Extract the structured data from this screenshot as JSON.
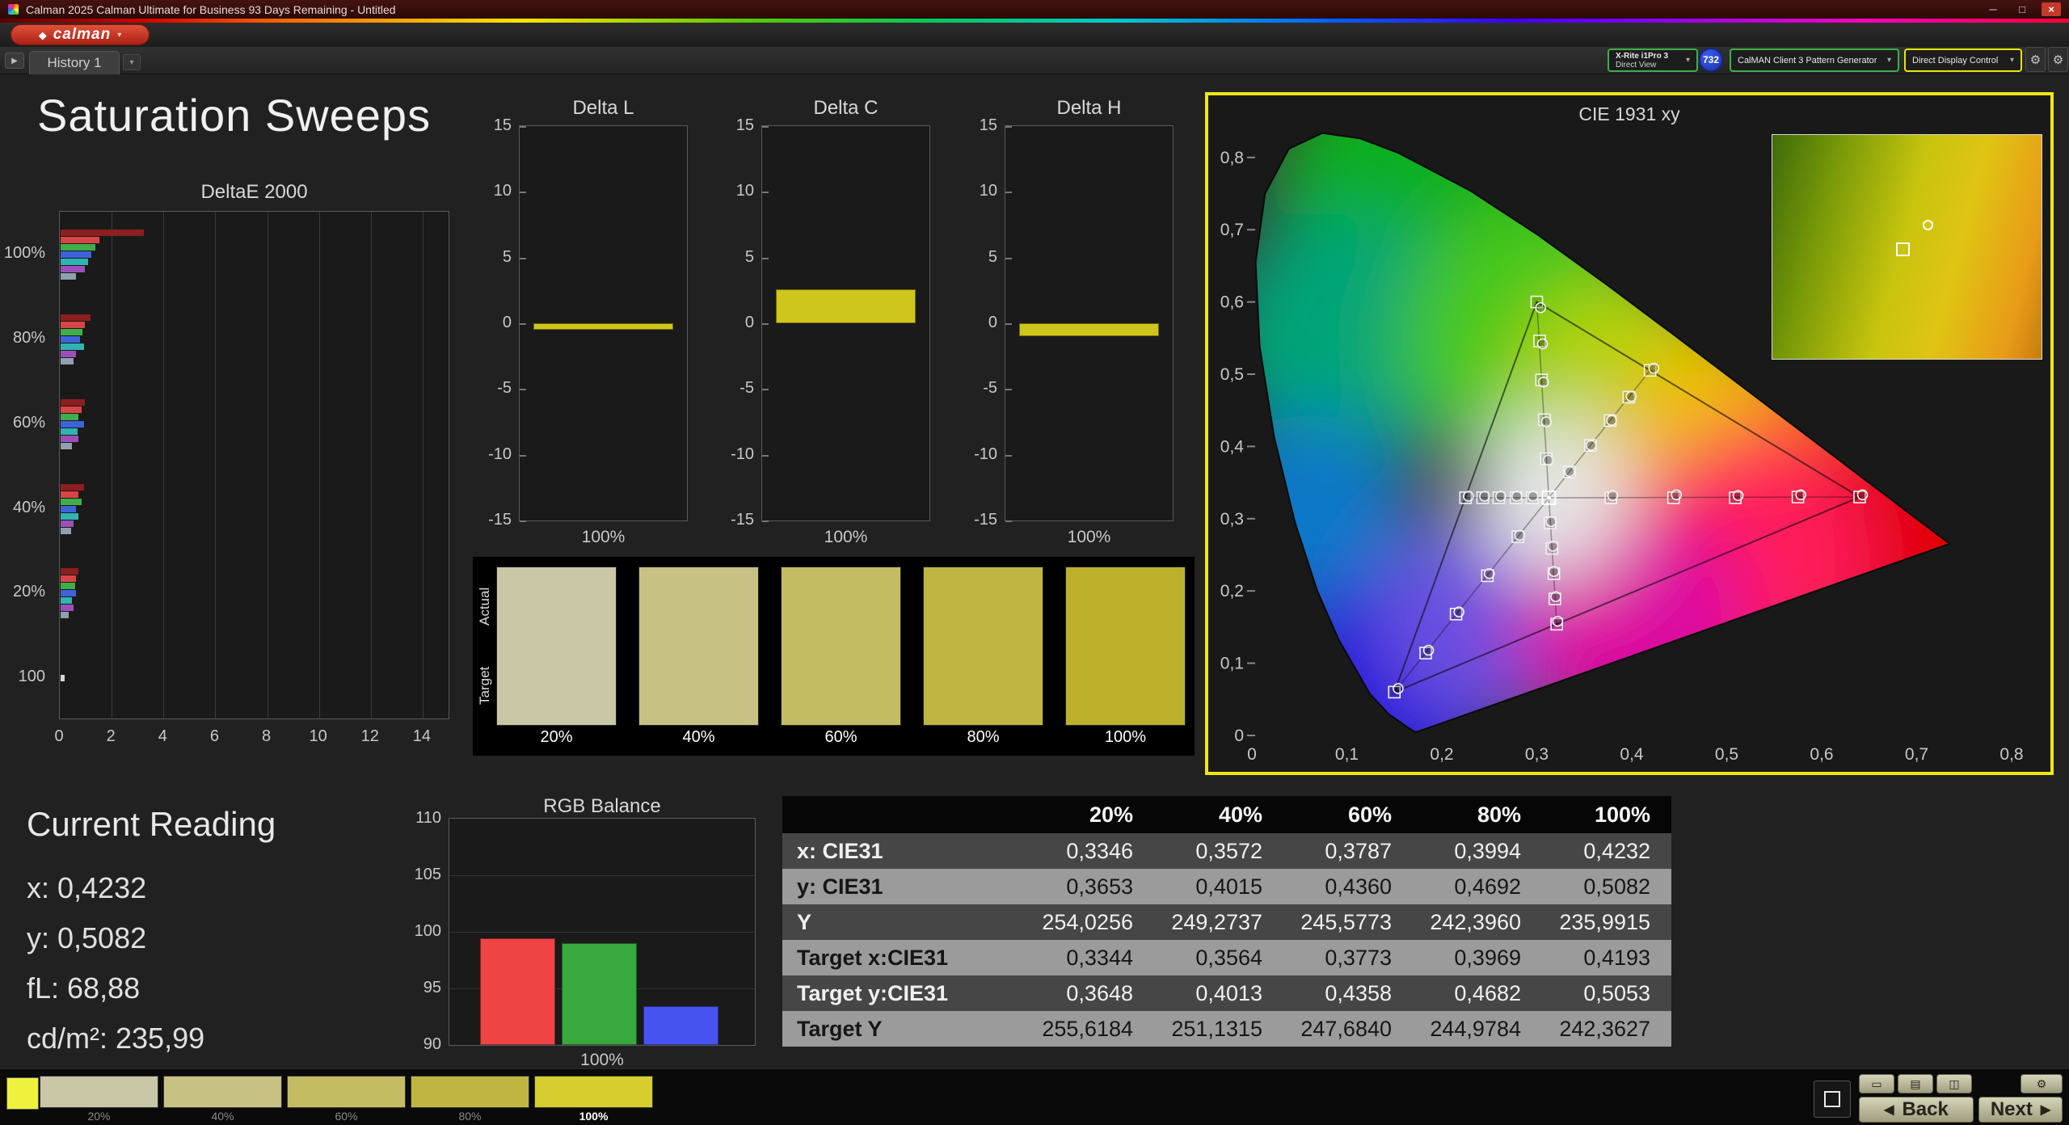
{
  "window": {
    "title": "Calman 2025 Calman Ultimate for Business 93 Days Remaining  - Untitled"
  },
  "logo": {
    "label": "calman"
  },
  "tab_bar": {
    "history_tab": "History 1"
  },
  "devices": {
    "meter_line1": "X-Rite i1Pro 3",
    "meter_line2": "Direct View",
    "meter_badge": "732",
    "source_label": "CalMAN Client 3 Pattern Generator",
    "display_label": "Direct Display Control",
    "meter_border_color": "#3fae4a",
    "source_border_color": "#3fae4a",
    "display_border_color": "#e6e600"
  },
  "page": {
    "title": "Saturation Sweeps"
  },
  "current_reading": {
    "title": "Current Reading",
    "x": "x: 0,4232",
    "y": "y: 0,5082",
    "fl": "fL: 68,88",
    "cd": "cd/m²: 235,99"
  },
  "saturation_swatches": {
    "row_label_top": "Actual",
    "row_label_bottom": "Target",
    "levels": [
      "20%",
      "40%",
      "60%",
      "80%",
      "100%"
    ],
    "colors": [
      "#c9c7a6",
      "#c7c184",
      "#c4bc62",
      "#c0b543",
      "#bdb02b"
    ]
  },
  "measurement_table": {
    "headers": [
      "",
      "20%",
      "40%",
      "60%",
      "80%",
      "100%"
    ],
    "rows": [
      {
        "label": "x: CIE31",
        "shade": "dark",
        "values": [
          "0,3346",
          "0,3572",
          "0,3787",
          "0,3994",
          "0,4232"
        ]
      },
      {
        "label": "y: CIE31",
        "shade": "light",
        "values": [
          "0,3653",
          "0,4015",
          "0,4360",
          "0,4692",
          "0,5082"
        ]
      },
      {
        "label": "Y",
        "shade": "dark",
        "values": [
          "254,0256",
          "249,2737",
          "245,5773",
          "242,3960",
          "235,9915"
        ]
      },
      {
        "label": "Target x:CIE31",
        "shade": "light",
        "values": [
          "0,3344",
          "0,3564",
          "0,3773",
          "0,3969",
          "0,4193"
        ]
      },
      {
        "label": "Target y:CIE31",
        "shade": "dark",
        "values": [
          "0,3648",
          "0,4013",
          "0,4358",
          "0,4682",
          "0,5053"
        ]
      },
      {
        "label": "Target Y",
        "shade": "light",
        "values": [
          "255,6184",
          "251,1315",
          "247,6840",
          "244,9784",
          "242,3627"
        ]
      }
    ]
  },
  "bottom_bar": {
    "current_color": "#eef23c",
    "levels": [
      {
        "label": "20%",
        "color": "#c9c7a6"
      },
      {
        "label": "40%",
        "color": "#c7c184"
      },
      {
        "label": "60%",
        "color": "#c4bc62"
      },
      {
        "label": "80%",
        "color": "#c0b543"
      },
      {
        "label": "100%",
        "color": "#d6cd2e"
      }
    ],
    "selected_level": "100%",
    "back_label": "Back",
    "next_label": "Next"
  },
  "chart_data": [
    {
      "id": "deltaE2000",
      "type": "bar",
      "title": "DeltaE 2000",
      "orientation": "horizontal",
      "categories": [
        "100%",
        "80%",
        "60%",
        "40%",
        "20%",
        "100"
      ],
      "xlim": [
        0,
        15
      ],
      "xticks": [
        0,
        2,
        4,
        6,
        8,
        10,
        12,
        14
      ],
      "series_colors": [
        "#8c1f1f",
        "#d94545",
        "#3fae4a",
        "#3f62d9",
        "#2fb3b3",
        "#9a50b8",
        "#8fa0b0"
      ],
      "groups": [
        [
          3.2,
          1.5,
          1.35,
          1.2,
          1.05,
          0.95,
          0.6
        ],
        [
          1.15,
          0.95,
          0.85,
          0.75,
          0.9,
          0.6,
          0.5
        ],
        [
          0.95,
          0.8,
          0.7,
          0.9,
          0.65,
          0.7,
          0.45
        ],
        [
          0.9,
          0.7,
          0.8,
          0.6,
          0.7,
          0.5,
          0.4
        ],
        [
          0.7,
          0.6,
          0.55,
          0.6,
          0.45,
          0.5,
          0.3
        ],
        [
          0.15
        ]
      ]
    },
    {
      "id": "deltaL",
      "type": "bar",
      "title": "Delta L",
      "ylim": [
        -15,
        15
      ],
      "yticks": [
        15,
        10,
        5,
        0,
        -5,
        -10,
        -15
      ],
      "xlabel": "100%",
      "value": -0.5,
      "bar_color": "#cfc61d"
    },
    {
      "id": "deltaC",
      "type": "bar",
      "title": "Delta C",
      "ylim": [
        -15,
        15
      ],
      "yticks": [
        15,
        10,
        5,
        0,
        -5,
        -10,
        -15
      ],
      "xlabel": "100%",
      "value": 2.6,
      "bar_color": "#cfc61d"
    },
    {
      "id": "deltaH",
      "type": "bar",
      "title": "Delta H",
      "ylim": [
        -15,
        15
      ],
      "yticks": [
        15,
        10,
        5,
        0,
        -5,
        -10,
        -15
      ],
      "xlabel": "100%",
      "value": -1.0,
      "bar_color": "#cfc61d"
    },
    {
      "id": "rgbBalance",
      "type": "bar",
      "title": "RGB Balance",
      "categories": [
        "Red",
        "Green",
        "Blue"
      ],
      "values": [
        99.4,
        99.0,
        93.4
      ],
      "bar_colors": [
        "#ef4444",
        "#37a93f",
        "#4753ef"
      ],
      "ylim": [
        90,
        110
      ],
      "yticks": [
        110,
        105,
        100,
        95,
        90
      ],
      "xlabel": "100%"
    },
    {
      "id": "cie",
      "type": "scatter",
      "title": "CIE 1931 xy",
      "xtick_labels": [
        "0",
        "0,1",
        "0,2",
        "0,3",
        "0,4",
        "0,5",
        "0,6",
        "0,7",
        "0,8"
      ],
      "xtick_values": [
        0,
        0.1,
        0.2,
        0.3,
        0.4,
        0.5,
        0.6,
        0.7,
        0.8
      ],
      "ytick_labels": [
        "0",
        "0,1",
        "0,2",
        "0,3",
        "0,4",
        "0,5",
        "0,6",
        "0,7",
        "0,8"
      ],
      "ytick_values": [
        0,
        0.1,
        0.2,
        0.3,
        0.4,
        0.5,
        0.6,
        0.7,
        0.8
      ],
      "white_point": [
        0.3127,
        0.329
      ],
      "gamut_triangle": [
        [
          0.64,
          0.33
        ],
        [
          0.3,
          0.6
        ],
        [
          0.15,
          0.06
        ]
      ],
      "spectral_locus": [
        [
          0.1741,
          0.005
        ],
        [
          0.1714,
          0.0051
        ],
        [
          0.1644,
          0.0109
        ],
        [
          0.144,
          0.0297
        ],
        [
          0.1241,
          0.0578
        ],
        [
          0.0913,
          0.1327
        ],
        [
          0.0687,
          0.2007
        ],
        [
          0.0454,
          0.295
        ],
        [
          0.0235,
          0.4127
        ],
        [
          0.0082,
          0.5384
        ],
        [
          0.0039,
          0.6548
        ],
        [
          0.0139,
          0.7502
        ],
        [
          0.0389,
          0.812
        ],
        [
          0.0743,
          0.8338
        ],
        [
          0.1142,
          0.8262
        ],
        [
          0.1547,
          0.8059
        ],
        [
          0.2296,
          0.7543
        ],
        [
          0.3016,
          0.6923
        ],
        [
          0.3731,
          0.6245
        ],
        [
          0.4441,
          0.5547
        ],
        [
          0.5125,
          0.4866
        ],
        [
          0.5752,
          0.4242
        ],
        [
          0.627,
          0.3725
        ],
        [
          0.6658,
          0.334
        ],
        [
          0.6915,
          0.3083
        ],
        [
          0.7079,
          0.292
        ],
        [
          0.726,
          0.274
        ],
        [
          0.7347,
          0.2653
        ]
      ],
      "sweeps": [
        {
          "name": "red",
          "targets": [
            [
              0.378,
              0.329
            ],
            [
              0.444,
              0.329
            ],
            [
              0.509,
              0.329
            ],
            [
              0.575,
              0.33
            ],
            [
              0.64,
              0.33
            ]
          ],
          "measured": [
            [
              0.38,
              0.332
            ],
            [
              0.447,
              0.333
            ],
            [
              0.512,
              0.332
            ],
            [
              0.578,
              0.333
            ],
            [
              0.643,
              0.333
            ]
          ]
        },
        {
          "name": "green",
          "targets": [
            [
              0.31,
              0.383
            ],
            [
              0.308,
              0.437
            ],
            [
              0.305,
              0.492
            ],
            [
              0.303,
              0.546
            ],
            [
              0.3,
              0.6
            ]
          ],
          "measured": [
            [
              0.312,
              0.381
            ],
            [
              0.31,
              0.434
            ],
            [
              0.307,
              0.489
            ],
            [
              0.306,
              0.542
            ],
            [
              0.304,
              0.592
            ]
          ]
        },
        {
          "name": "blue",
          "targets": [
            [
              0.28,
              0.275
            ],
            [
              0.248,
              0.221
            ],
            [
              0.215,
              0.168
            ],
            [
              0.183,
              0.114
            ],
            [
              0.15,
              0.06
            ]
          ],
          "measured": [
            [
              0.282,
              0.277
            ],
            [
              0.25,
              0.224
            ],
            [
              0.218,
              0.171
            ],
            [
              0.186,
              0.118
            ],
            [
              0.154,
              0.065
            ]
          ]
        },
        {
          "name": "cyan",
          "targets": [
            [
              0.295,
              0.329
            ],
            [
              0.278,
              0.329
            ],
            [
              0.26,
              0.329
            ],
            [
              0.243,
              0.329
            ],
            [
              0.225,
              0.329
            ]
          ],
          "measured": [
            [
              0.296,
              0.331
            ],
            [
              0.279,
              0.331
            ],
            [
              0.262,
              0.331
            ],
            [
              0.245,
              0.331
            ],
            [
              0.228,
              0.331
            ]
          ]
        },
        {
          "name": "magenta",
          "targets": [
            [
              0.314,
              0.294
            ],
            [
              0.316,
              0.259
            ],
            [
              0.318,
              0.224
            ],
            [
              0.319,
              0.189
            ],
            [
              0.321,
              0.154
            ]
          ],
          "measured": [
            [
              0.315,
              0.296
            ],
            [
              0.317,
              0.262
            ],
            [
              0.318,
              0.227
            ],
            [
              0.32,
              0.192
            ],
            [
              0.322,
              0.158
            ]
          ]
        },
        {
          "name": "yellow",
          "targets": [
            [
              0.3344,
              0.3648
            ],
            [
              0.3564,
              0.4013
            ],
            [
              0.3773,
              0.4358
            ],
            [
              0.3969,
              0.4682
            ],
            [
              0.4193,
              0.5053
            ]
          ],
          "measured": [
            [
              0.3346,
              0.3653
            ],
            [
              0.3572,
              0.4015
            ],
            [
              0.3787,
              0.436
            ],
            [
              0.3994,
              0.4692
            ],
            [
              0.4232,
              0.5082
            ]
          ]
        }
      ]
    }
  ]
}
